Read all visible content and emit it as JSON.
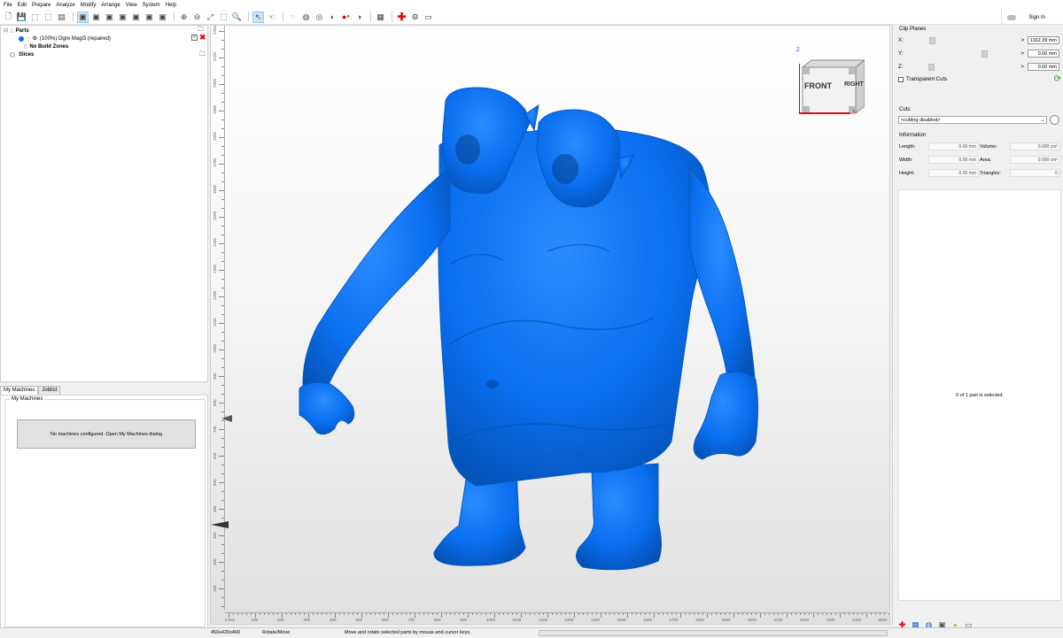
{
  "menu": [
    "File",
    "Edit",
    "Prepare",
    "Analyze",
    "Modify",
    "Arrange",
    "View",
    "System",
    "Help"
  ],
  "toolbar": {
    "signin": "Sign In"
  },
  "tree": {
    "parts_label": "Parts",
    "part_name": "(100%) Ogre Magi3 (repaired)",
    "no_build": "No Build Zones",
    "slices": "Slices"
  },
  "machines": {
    "tab_active": "My Machines",
    "tab_other": "Joblist",
    "group_label": "My Machines",
    "empty_msg": "No machines configured. Open My Machines dialog"
  },
  "viewport": {
    "part_color": "#0a6ff0",
    "cube_front": "FRONT",
    "cube_right": "RIGHT",
    "axis_z": "Z",
    "axis_x": "X",
    "vruler_labels": [
      "2200",
      "2100",
      "2000",
      "1900",
      "1800",
      "1700",
      "1600",
      "1500",
      "1400",
      "1300",
      "1200",
      "1100",
      "1000",
      "900",
      "800",
      "700",
      "600",
      "500",
      "400",
      "300",
      "200",
      "100"
    ],
    "hruler_labels": [
      "0 mm",
      "100",
      "200",
      "300",
      "400",
      "500",
      "600",
      "700",
      "800",
      "900",
      "1000",
      "1100",
      "1200",
      "1300",
      "1400",
      "1500",
      "1600",
      "1700",
      "1800",
      "1900",
      "2000",
      "2100",
      "2200",
      "2300",
      "2400",
      "2500"
    ]
  },
  "clip": {
    "title": "Clip Planes",
    "x_label": "X:",
    "y_label": "Y:",
    "z_label": "Z:",
    "x_value": "1162.39 mm",
    "y_value": "0.00 mm",
    "z_value": "0.00 mm",
    "transparent_cuts": "Transparent Cuts"
  },
  "cuts": {
    "title": "Cuts",
    "selected": "<cutting disabled>"
  },
  "information": {
    "title": "Information",
    "length_label": "Length:",
    "length_value": "0.00 mm",
    "width_label": "Width:",
    "width_value": "0.00 mm",
    "height_label": "Height:",
    "height_value": "0.00 mm",
    "volume_label": "Volume:",
    "volume_value": "0.000 cm³",
    "area_label": "Area:",
    "area_value": "0.000 cm²",
    "triangles_label": "Triangles:",
    "triangles_value": "0"
  },
  "selection_msg": "0 of 1 part is selected.",
  "status": {
    "dims": "450x420x400",
    "mode": "Rotate/Move",
    "hint": "Move and rotate selected parts by mouse and cursor keys."
  }
}
